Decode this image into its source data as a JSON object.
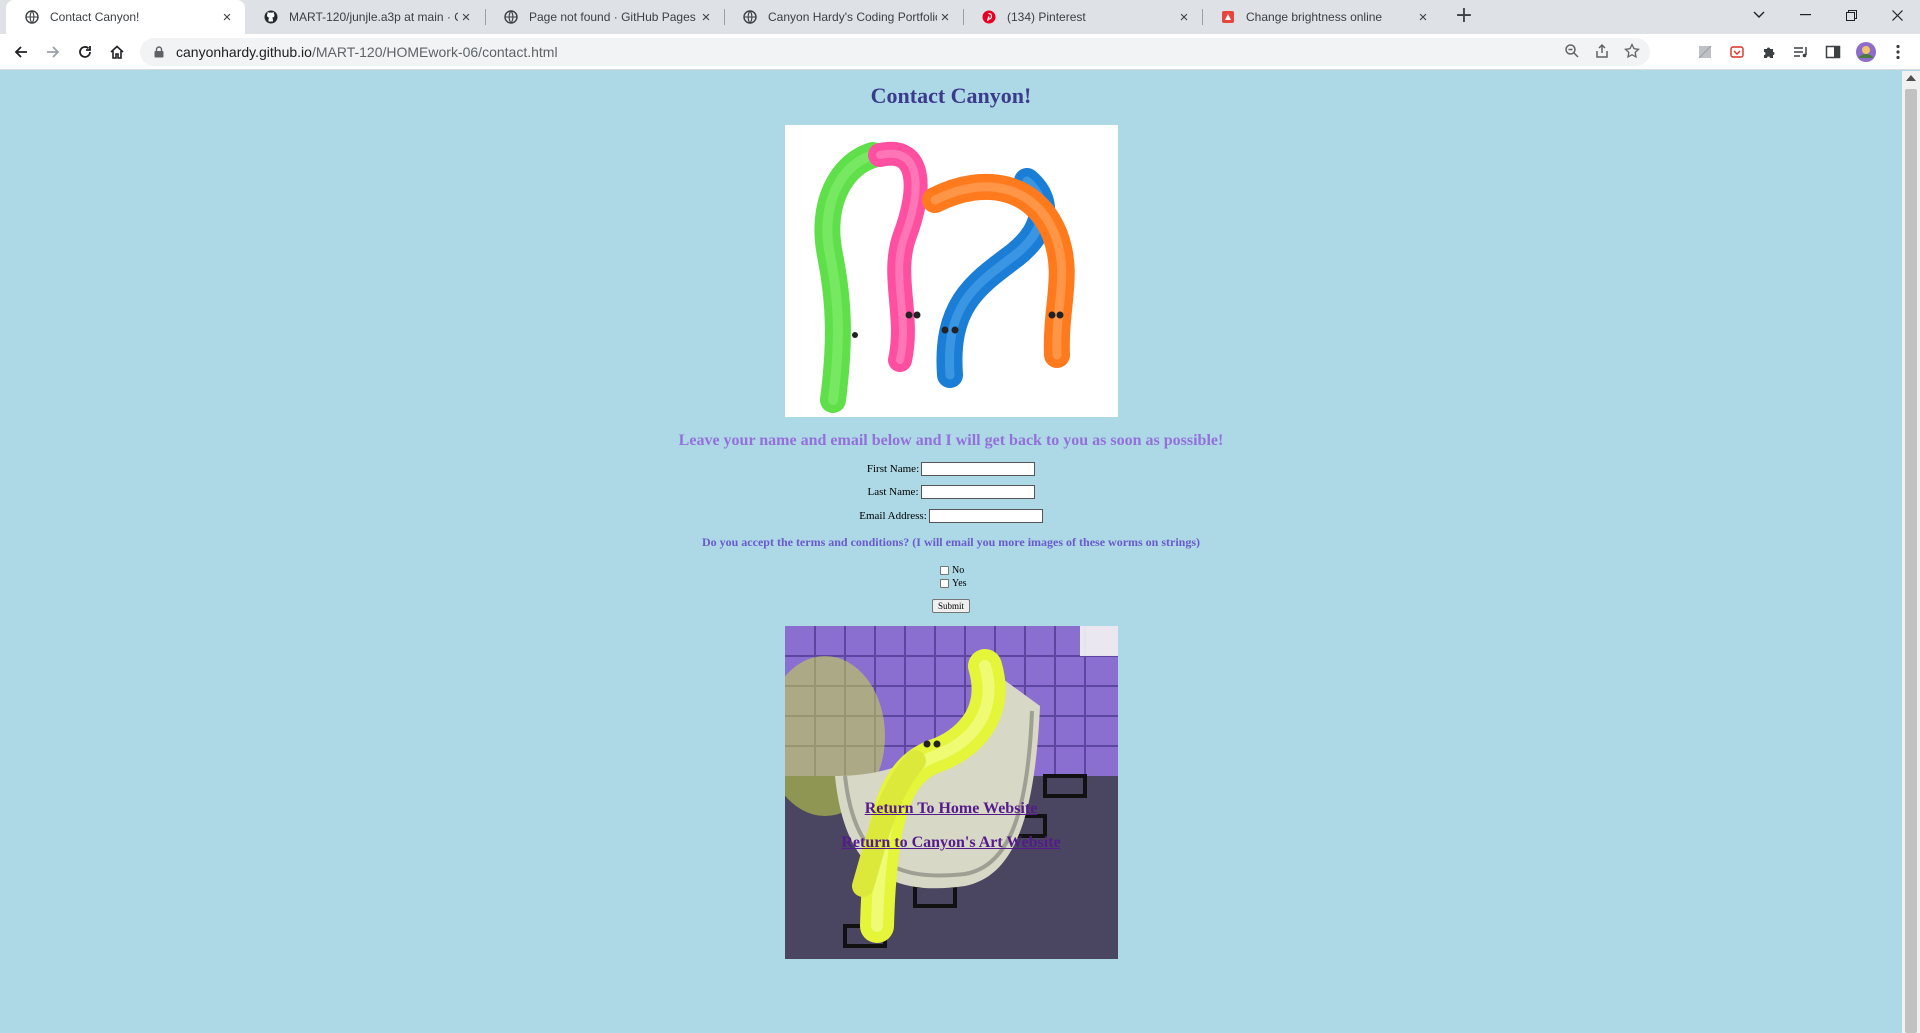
{
  "browser": {
    "tabs": [
      {
        "title": "Contact Canyon!",
        "icon": "globe-icon",
        "active": true
      },
      {
        "title": "MART-120/junjle.a3p at main · Ca",
        "icon": "github-icon",
        "active": false
      },
      {
        "title": "Page not found · GitHub Pages",
        "icon": "globe-icon",
        "active": false
      },
      {
        "title": "Canyon Hardy's Coding Portfolio",
        "icon": "globe-icon",
        "active": false
      },
      {
        "title": "(134) Pinterest",
        "icon": "pinterest-icon",
        "active": false
      },
      {
        "title": "Change brightness online",
        "icon": "brightness-site-icon",
        "active": false
      }
    ],
    "tab_close_glyph": "×",
    "new_tab_glyph": "+",
    "url_host": "canyonhardy.github.io",
    "url_path": "/MART-120/HOMEwork-06/contact.html"
  },
  "page": {
    "title": "Contact Canyon!",
    "subheading": "Leave your name and email below and I will get back to you as soon as possible!",
    "form": {
      "first_name_label": "First Name:",
      "last_name_label": "Last Name:",
      "email_label": "Email Address:",
      "terms_question": "Do you accept the terms and conditions? (I will email you more images of these worms on strings)",
      "option_no": "No",
      "option_yes": "Yes",
      "submit_label": "Submit"
    },
    "links": {
      "home": "Return To Home Website",
      "art": "Return to Canyon's Art Website"
    }
  },
  "colors": {
    "page_background": "#add8e6",
    "title_color": "#3b3b8c",
    "subheading_color": "#9370db",
    "terms_color": "#6a5acd",
    "link_color": "#551a8b"
  }
}
